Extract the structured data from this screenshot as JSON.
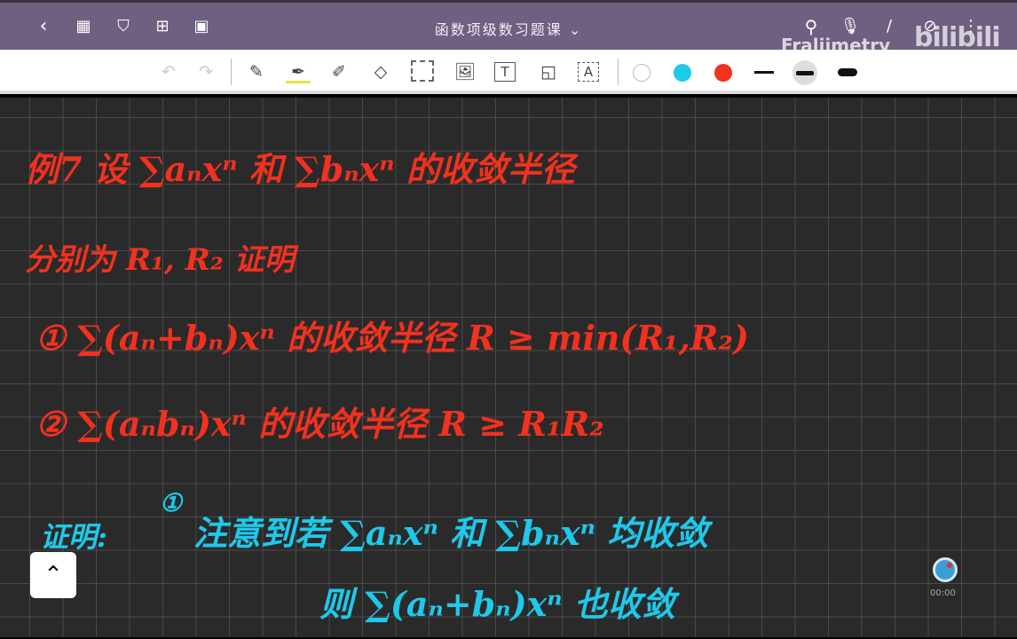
{
  "header": {
    "title": "函数项级数习题课",
    "title_chevron": "⌄",
    "watermark": "Fraliimetry",
    "brand": "bilibili"
  },
  "toolbar": {
    "colors": {
      "white": "#ffffff",
      "cyan": "#1ec9ea",
      "red": "#f2311f"
    }
  },
  "note": {
    "red_lines": [
      "例7  设 ∑aₙxⁿ 和 ∑bₙxⁿ 的收敛半径",
      "分别为 R₁, R₂  证明",
      "①  ∑(aₙ+bₙ)xⁿ 的收敛半径 R ≥ min(R₁,R₂)",
      "②  ∑(aₙbₙ)xⁿ 的收敛半径 R ≥ R₁R₂"
    ],
    "cyan_lines": [
      "证明:",
      "①",
      "注意到若 ∑aₙxⁿ 和 ∑bₙxⁿ 均收敛",
      "则 ∑(aₙ+bₙ)xⁿ 也收敛"
    ]
  },
  "recorder": {
    "time": "00:00"
  }
}
